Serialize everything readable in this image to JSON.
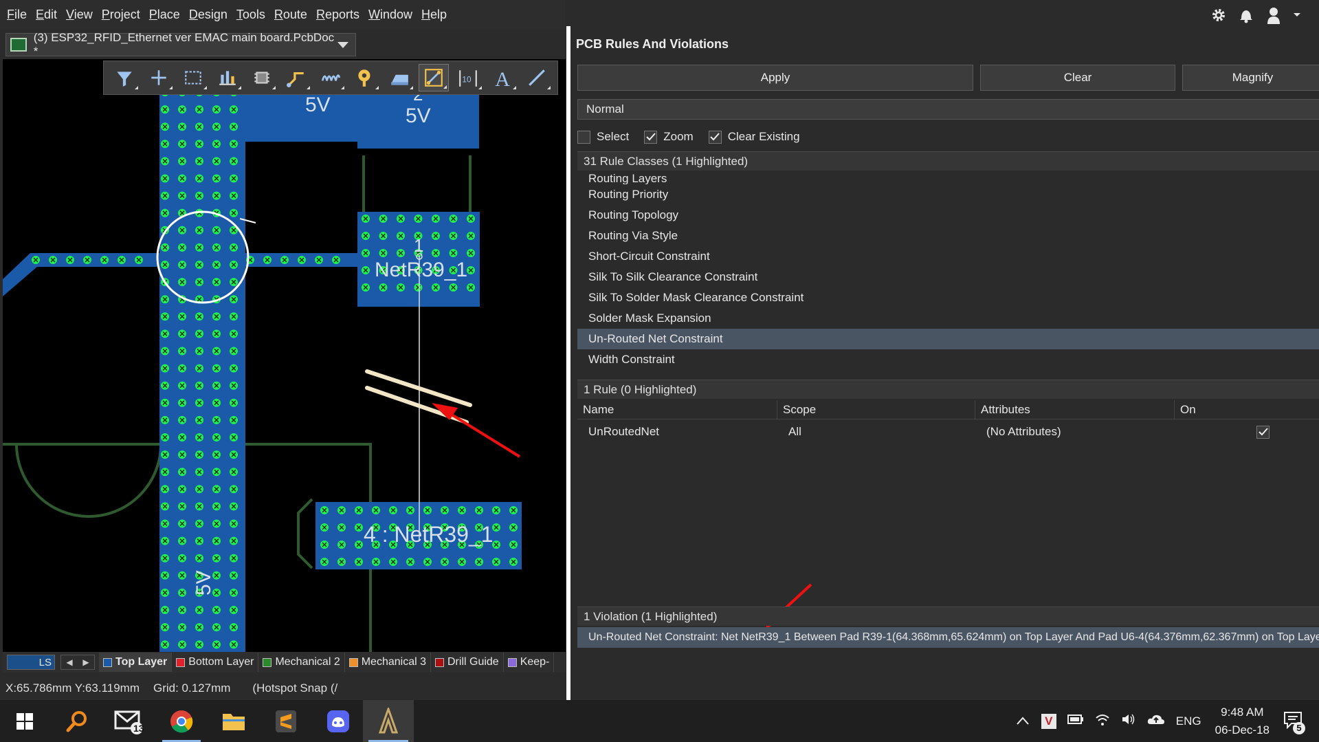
{
  "menu": {
    "items": [
      {
        "id": "file",
        "first": "F",
        "rest": "ile"
      },
      {
        "id": "edit",
        "first": "E",
        "rest": "dit"
      },
      {
        "id": "view",
        "first": "V",
        "rest": "iew"
      },
      {
        "id": "project",
        "first": "P",
        "rest": "roject"
      },
      {
        "id": "place",
        "first": "P",
        "rest": "lace"
      },
      {
        "id": "design",
        "first": "D",
        "rest": "esign"
      },
      {
        "id": "tools",
        "first": "T",
        "rest": "ools"
      },
      {
        "id": "route",
        "first": "R",
        "rest": "oute"
      },
      {
        "id": "reports",
        "first": "R",
        "rest": "eports"
      },
      {
        "id": "window",
        "first": "W",
        "rest": "indow"
      },
      {
        "id": "help",
        "first": "H",
        "rest": "elp"
      }
    ]
  },
  "document_tab": {
    "title": "(3) ESP32_RFID_Ethernet ver EMAC main board.PcbDoc *"
  },
  "toolbar": {
    "icons": [
      "filter-icon",
      "cross-select-icon",
      "rect-select-icon",
      "align-icon",
      "component-icon",
      "route-icon",
      "interactive-length-icon",
      "via-icon",
      "fill-icon",
      "dimension-icon",
      "text-frame-icon",
      "string-icon",
      "line-icon"
    ]
  },
  "canvas": {
    "labels": {
      "pad_top_left": "5V",
      "pad_top_right_num": "2",
      "pad_top_right_net": "5V",
      "pad_mid_num": "1",
      "pad_mid_net": "NetR39_1",
      "pad_bottom": "4 : NetR39_1",
      "trace_vertical": "5V"
    },
    "colors": {
      "copper": "#1a5aa8",
      "via_dot": "#22ee55",
      "board_outline": "#2f5a2f",
      "highlight": "#ffffff",
      "arrow": "#ee1111",
      "cursor": "#f3e6c6"
    }
  },
  "layers": {
    "ls_label": "LS",
    "tabs": [
      {
        "name": "Top Layer",
        "color": "#1a5aa8",
        "active": true
      },
      {
        "name": "Bottom Layer",
        "color": "#e0202a",
        "active": false
      },
      {
        "name": "Mechanical 2",
        "color": "#2b8a2b",
        "active": false
      },
      {
        "name": "Mechanical 3",
        "color": "#f0902a",
        "active": false
      },
      {
        "name": "Drill Guide",
        "color": "#aa1010",
        "active": false
      },
      {
        "name": "Keep-",
        "color": "#8a6ad8",
        "active": false
      }
    ]
  },
  "status": {
    "coords": "X:65.786mm Y:63.119mm",
    "grid": "Grid: 0.127mm",
    "snap": "(Hotspot Snap (/"
  },
  "panel": {
    "title": "PCB Rules And Violations",
    "buttons": {
      "apply": "Apply",
      "clear": "Clear",
      "magnify": "Magnify"
    },
    "mode": "Normal",
    "checks": [
      {
        "label": "Select",
        "checked": false
      },
      {
        "label": "Zoom",
        "checked": true
      },
      {
        "label": "Clear Existing",
        "checked": true
      }
    ],
    "rule_classes_header": "31 Rule Classes (1 Highlighted)",
    "rule_classes": [
      {
        "label": "Routing Layers",
        "hl": false
      },
      {
        "label": "Routing Priority",
        "hl": false
      },
      {
        "label": "Routing Topology",
        "hl": false
      },
      {
        "label": "Routing Via Style",
        "hl": false
      },
      {
        "label": "Short-Circuit Constraint",
        "hl": false
      },
      {
        "label": "Silk To Silk Clearance Constraint",
        "hl": false
      },
      {
        "label": "Silk To Solder Mask Clearance Constraint",
        "hl": false
      },
      {
        "label": "Solder Mask Expansion",
        "hl": false
      },
      {
        "label": "Un-Routed Net Constraint",
        "hl": true
      },
      {
        "label": "Width Constraint",
        "hl": false
      }
    ],
    "rules_header": "1 Rule (0 Highlighted)",
    "rule_columns": {
      "name": "Name",
      "scope": "Scope",
      "attributes": "Attributes",
      "on": "On"
    },
    "rule_row": {
      "name": "UnRoutedNet",
      "scope": "All",
      "attributes": "(No Attributes)",
      "on": true
    },
    "violations_header": "1 Violation (1 Highlighted)",
    "violation": "Un-Routed Net Constraint: Net NetR39_1 Between Pad R39-1(64.368mm,65.624mm) on Top Layer And Pad U6-4(64.376mm,62.367mm) on Top Laye"
  },
  "taskbar": {
    "apps": [
      "windows-start-icon",
      "search-icon",
      "mail-icon",
      "chrome-icon",
      "file-explorer-icon",
      "sublime-icon",
      "discord-icon",
      "altium-icon"
    ],
    "mail_badge": "13",
    "lang": "ENG",
    "time": "9:48 AM",
    "date": "06-Dec-18",
    "notif_badge": "5"
  }
}
